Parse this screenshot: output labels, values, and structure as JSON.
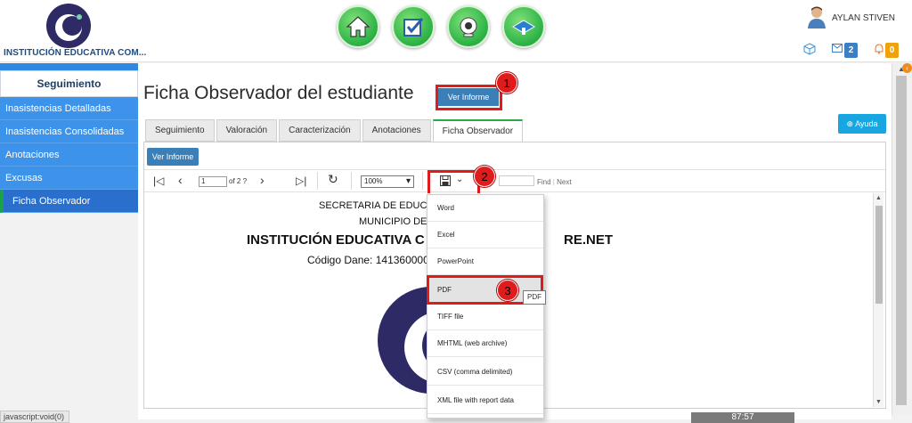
{
  "header": {
    "institution_name": "INSTITUCIÓN EDUCATIVA COM...",
    "nav_icons": [
      "home-icon",
      "check-icon",
      "webcam-icon",
      "graduation-icon"
    ],
    "user_name": "AYLAN STIVEN",
    "mail_count": "2",
    "bell_count": "0",
    "accent_green": "#2bb144"
  },
  "sidebar": {
    "title": "Seguimiento",
    "items": [
      {
        "label": "Inasistencias Detalladas"
      },
      {
        "label": "Inasistencias Consolidadas"
      },
      {
        "label": "Anotaciones"
      },
      {
        "label": "Excusas"
      },
      {
        "label": "Ficha Observador"
      }
    ],
    "status_text": "javascript:void(0)"
  },
  "main": {
    "page_title": "Ficha Observador del estudiante",
    "ver_informe_label": "Ver Informe",
    "ayuda_label": "Ayuda",
    "tabs": [
      {
        "label": "Seguimiento"
      },
      {
        "label": "Valoración"
      },
      {
        "label": "Caracterización"
      },
      {
        "label": "Anotaciones"
      },
      {
        "label": "Ficha Observador"
      }
    ],
    "inner_button_label": "Ver Informe"
  },
  "toolbar": {
    "page_value": "1",
    "of_text": "of 2 ?",
    "zoom": "100%",
    "find_label": "Find",
    "next_label": "Next"
  },
  "document": {
    "line1": "SECRETARIA DE EDUCA",
    "line2": "MUNICIPIO DE",
    "line3": "INSTITUCIÓN EDUCATIVA C",
    "line3_tail": "RE.NET",
    "line4": "Código Dane: 141360000"
  },
  "export_menu": {
    "items": [
      "Word",
      "Excel",
      "PowerPoint",
      "PDF",
      "TIFF file",
      "MHTML (web archive)",
      "CSV (comma delimited)",
      "XML file with report data"
    ],
    "tooltip": "PDF"
  },
  "annotations": {
    "a1": "1",
    "a2": "2",
    "a3": "3",
    "color": "#e01b1b"
  },
  "timer": "87:57"
}
